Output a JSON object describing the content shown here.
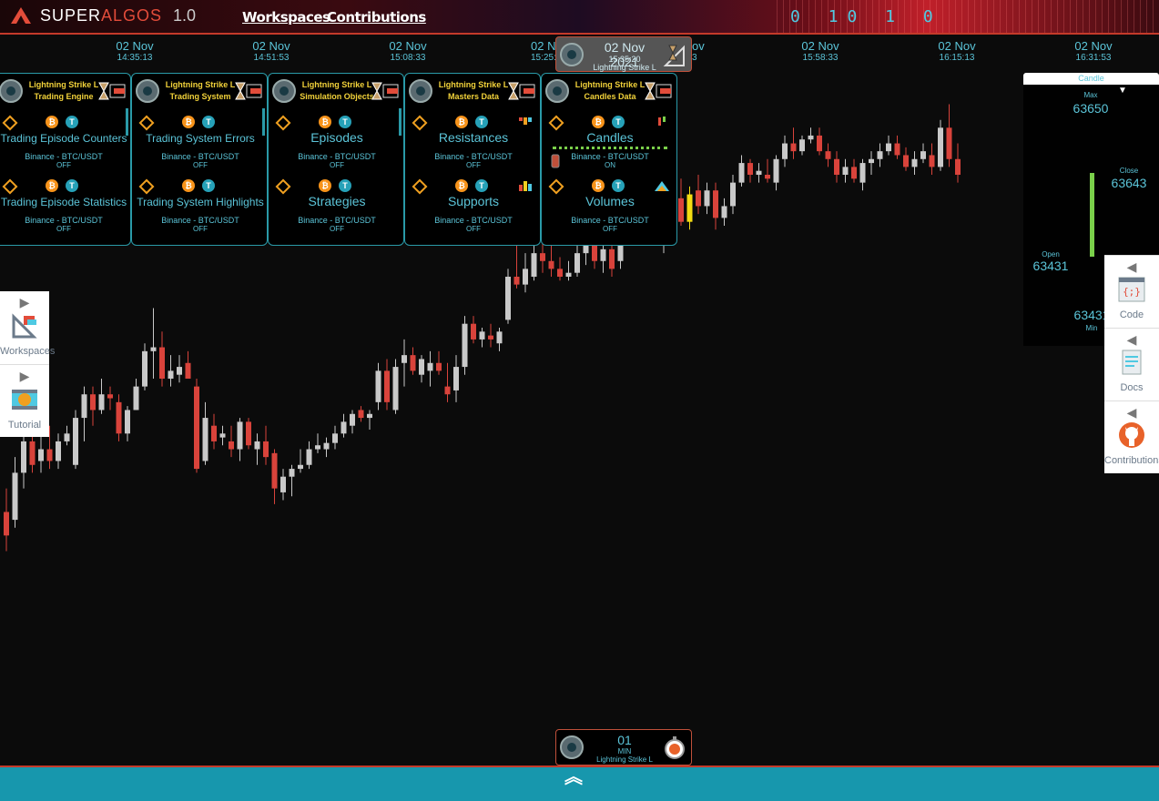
{
  "header": {
    "brand_left": "SUPER",
    "brand_right": "ALGOS",
    "version": "1.0",
    "nav": [
      {
        "label": "Workspaces"
      },
      {
        "label": "Contributions"
      }
    ],
    "binary_text": "0 10 1 0"
  },
  "timeline": [
    {
      "date": "02 Nov",
      "time": "14:35:13"
    },
    {
      "date": "02 Nov",
      "time": "14:51:53"
    },
    {
      "date": "02 Nov",
      "time": "15:08:33"
    },
    {
      "date": "02 N",
      "time": "15:25:1"
    },
    {
      "date": "ov",
      "time": "3"
    },
    {
      "date": "02 Nov",
      "time": "15:58:33"
    },
    {
      "date": "02 Nov",
      "time": "16:15:13"
    },
    {
      "date": "02 Nov",
      "time": "16:31:53"
    }
  ],
  "date_pill": {
    "date": "02 Nov 2021",
    "time": "15:35:20",
    "session": "Lightning Strike L"
  },
  "panels": [
    {
      "title1": "Lightning Strike L",
      "title2": "Trading Engine",
      "layers": [
        {
          "name": "Trading Episode Counters",
          "market": "Binance - BTC/USDT",
          "status": "OFF"
        },
        {
          "name": "Trading Episode Statistics",
          "market": "Binance - BTC/USDT",
          "status": "OFF"
        }
      ]
    },
    {
      "title1": "Lightning Strike L",
      "title2": "Trading System",
      "layers": [
        {
          "name": "Trading System Errors",
          "market": "Binance - BTC/USDT",
          "status": "OFF"
        },
        {
          "name": "Trading System Highlights",
          "market": "Binance - BTC/USDT",
          "status": "OFF"
        }
      ]
    },
    {
      "title1": "Lightning Strike L",
      "title2": "Simulation Objects",
      "layers": [
        {
          "name": "Episodes",
          "market": "Binance - BTC/USDT",
          "status": "OFF"
        },
        {
          "name": "Strategies",
          "market": "Binance - BTC/USDT",
          "status": "OFF"
        }
      ]
    },
    {
      "title1": "Lightning Strike L",
      "title2": "Masters Data",
      "layers": [
        {
          "name": "Resistances",
          "market": "Binance - BTC/USDT",
          "status": "OFF"
        },
        {
          "name": "Supports",
          "market": "Binance - BTC/USDT",
          "status": "OFF"
        }
      ]
    },
    {
      "title1": "Lightning Strike L",
      "title2": "Candles Data",
      "layers": [
        {
          "name": "Candles",
          "market": "Binance - BTC/USDT",
          "status": "ON"
        },
        {
          "name": "Volumes",
          "market": "Binance - BTC/USDT",
          "status": "OFF"
        }
      ]
    }
  ],
  "left_tabs": [
    {
      "label": "Workspaces"
    },
    {
      "label": "Tutorial"
    }
  ],
  "right_tabs": [
    {
      "label": "Code"
    },
    {
      "label": "Docs"
    },
    {
      "label": "Contributions"
    }
  ],
  "candle_panel": {
    "title": "Candle",
    "max_label": "Max",
    "max_value": "63650",
    "close_label": "Close",
    "close_value": "63643",
    "open_label": "Open",
    "open_value": "63431",
    "min_label": "Min",
    "min_value": "63431"
  },
  "time_frame": {
    "value": "01",
    "unit": "MIN",
    "session": "Lightning Strike L"
  },
  "colors": {
    "up": "#c9c9c9",
    "down": "#d9433b",
    "current": "#f4dc12",
    "accent": "#5bc4d8",
    "panel_border": "#2a9aa8",
    "bottom_bar": "#1797ad"
  },
  "chart_data": {
    "type": "candlestick",
    "title": "",
    "xlabel": "",
    "ylabel": "",
    "candles": [
      {
        "o": 62340,
        "h": 62370,
        "l": 62290,
        "c": 62310
      },
      {
        "o": 62330,
        "h": 62410,
        "l": 62320,
        "c": 62390
      },
      {
        "o": 62390,
        "h": 62440,
        "l": 62370,
        "c": 62430
      },
      {
        "o": 62430,
        "h": 62445,
        "l": 62390,
        "c": 62400
      },
      {
        "o": 62405,
        "h": 62440,
        "l": 62390,
        "c": 62420
      },
      {
        "o": 62420,
        "h": 62450,
        "l": 62395,
        "c": 62405
      },
      {
        "o": 62405,
        "h": 62440,
        "l": 62395,
        "c": 62430
      },
      {
        "o": 62430,
        "h": 62450,
        "l": 62425,
        "c": 62440
      },
      {
        "o": 62400,
        "h": 62470,
        "l": 62395,
        "c": 62460
      },
      {
        "o": 62460,
        "h": 62500,
        "l": 62430,
        "c": 62490
      },
      {
        "o": 62490,
        "h": 62500,
        "l": 62450,
        "c": 62470
      },
      {
        "o": 62470,
        "h": 62510,
        "l": 62465,
        "c": 62490
      },
      {
        "o": 62490,
        "h": 62500,
        "l": 62470,
        "c": 62485
      },
      {
        "o": 62480,
        "h": 62490,
        "l": 62430,
        "c": 62440
      },
      {
        "o": 62440,
        "h": 62475,
        "l": 62430,
        "c": 62470
      },
      {
        "o": 62470,
        "h": 62510,
        "l": 62470,
        "c": 62500
      },
      {
        "o": 62500,
        "h": 62555,
        "l": 62495,
        "c": 62545
      },
      {
        "o": 62545,
        "h": 62600,
        "l": 62510,
        "c": 62550
      },
      {
        "o": 62550,
        "h": 62570,
        "l": 62500,
        "c": 62510
      },
      {
        "o": 62510,
        "h": 62540,
        "l": 62500,
        "c": 62520
      },
      {
        "o": 62515,
        "h": 62540,
        "l": 62505,
        "c": 62525
      },
      {
        "o": 62530,
        "h": 62545,
        "l": 62510,
        "c": 62510
      },
      {
        "o": 62500,
        "h": 62510,
        "l": 62390,
        "c": 62395
      },
      {
        "o": 62405,
        "h": 62480,
        "l": 62400,
        "c": 62460
      },
      {
        "o": 62450,
        "h": 62465,
        "l": 62420,
        "c": 62430
      },
      {
        "o": 62435,
        "h": 62450,
        "l": 62425,
        "c": 62440
      },
      {
        "o": 62430,
        "h": 62450,
        "l": 62410,
        "c": 62420
      },
      {
        "o": 62420,
        "h": 62460,
        "l": 62405,
        "c": 62455
      },
      {
        "o": 62455,
        "h": 62460,
        "l": 62420,
        "c": 62425
      },
      {
        "o": 62420,
        "h": 62440,
        "l": 62400,
        "c": 62430
      },
      {
        "o": 62430,
        "h": 62450,
        "l": 62400,
        "c": 62410
      },
      {
        "o": 62415,
        "h": 62420,
        "l": 62350,
        "c": 62370
      },
      {
        "o": 62365,
        "h": 62395,
        "l": 62355,
        "c": 62385
      },
      {
        "o": 62385,
        "h": 62400,
        "l": 62360,
        "c": 62395
      },
      {
        "o": 62395,
        "h": 62420,
        "l": 62390,
        "c": 62400
      },
      {
        "o": 62400,
        "h": 62430,
        "l": 62395,
        "c": 62420
      },
      {
        "o": 62420,
        "h": 62440,
        "l": 62415,
        "c": 62425
      },
      {
        "o": 62420,
        "h": 62435,
        "l": 62410,
        "c": 62428
      },
      {
        "o": 62428,
        "h": 62450,
        "l": 62420,
        "c": 62440
      },
      {
        "o": 62440,
        "h": 62465,
        "l": 62435,
        "c": 62455
      },
      {
        "o": 62450,
        "h": 62470,
        "l": 62440,
        "c": 62465
      },
      {
        "o": 62470,
        "h": 62475,
        "l": 62455,
        "c": 62460
      },
      {
        "o": 62460,
        "h": 62470,
        "l": 62445,
        "c": 62465
      },
      {
        "o": 62480,
        "h": 62530,
        "l": 62470,
        "c": 62520
      },
      {
        "o": 62520,
        "h": 62535,
        "l": 62470,
        "c": 62480
      },
      {
        "o": 62470,
        "h": 62535,
        "l": 62465,
        "c": 62525
      },
      {
        "o": 62530,
        "h": 62560,
        "l": 62500,
        "c": 62540
      },
      {
        "o": 62540,
        "h": 62550,
        "l": 62515,
        "c": 62520
      },
      {
        "o": 62515,
        "h": 62540,
        "l": 62505,
        "c": 62535
      },
      {
        "o": 62520,
        "h": 62545,
        "l": 62500,
        "c": 62530
      },
      {
        "o": 62530,
        "h": 62545,
        "l": 62515,
        "c": 62520
      },
      {
        "o": 62500,
        "h": 62530,
        "l": 62480,
        "c": 62490
      },
      {
        "o": 62495,
        "h": 62540,
        "l": 62480,
        "c": 62525
      },
      {
        "o": 62525,
        "h": 62590,
        "l": 62515,
        "c": 62580
      },
      {
        "o": 62580,
        "h": 62590,
        "l": 62555,
        "c": 62560
      },
      {
        "o": 62560,
        "h": 62575,
        "l": 62550,
        "c": 62570
      },
      {
        "o": 62565,
        "h": 62580,
        "l": 62550,
        "c": 62560
      },
      {
        "o": 62555,
        "h": 62575,
        "l": 62545,
        "c": 62570
      },
      {
        "o": 62585,
        "h": 62650,
        "l": 62580,
        "c": 62640
      },
      {
        "o": 62640,
        "h": 62700,
        "l": 62625,
        "c": 62630
      },
      {
        "o": 62630,
        "h": 62670,
        "l": 62620,
        "c": 62650
      },
      {
        "o": 62640,
        "h": 62690,
        "l": 62635,
        "c": 62670
      },
      {
        "o": 62670,
        "h": 62700,
        "l": 62645,
        "c": 62660
      },
      {
        "o": 62660,
        "h": 62680,
        "l": 62640,
        "c": 62650
      },
      {
        "o": 62650,
        "h": 62665,
        "l": 62635,
        "c": 62640
      },
      {
        "o": 62640,
        "h": 62660,
        "l": 62635,
        "c": 62645
      },
      {
        "o": 62645,
        "h": 62680,
        "l": 62640,
        "c": 62670
      },
      {
        "o": 62670,
        "h": 62700,
        "l": 62655,
        "c": 62690
      },
      {
        "o": 62690,
        "h": 62705,
        "l": 62650,
        "c": 62660
      },
      {
        "o": 62660,
        "h": 62680,
        "l": 62645,
        "c": 62675
      },
      {
        "o": 62675,
        "h": 62690,
        "l": 62640,
        "c": 62650
      },
      {
        "o": 62660,
        "h": 62720,
        "l": 62650,
        "c": 62710
      },
      {
        "o": 62710,
        "h": 62725,
        "l": 62680,
        "c": 62690
      },
      {
        "o": 62690,
        "h": 62710,
        "l": 62685,
        "c": 62700
      },
      {
        "o": 62700,
        "h": 62720,
        "l": 62690,
        "c": 62710
      },
      {
        "o": 62715,
        "h": 62730,
        "l": 62680,
        "c": 62690
      },
      {
        "o": 62690,
        "h": 62705,
        "l": 62670,
        "c": 62700
      },
      {
        "o": 62705,
        "h": 62750,
        "l": 62700,
        "c": 62740
      },
      {
        "o": 62740,
        "h": 62765,
        "l": 62705,
        "c": 62710
      },
      {
        "o": 62710,
        "h": 62755,
        "l": 62700,
        "c": 62745
      },
      {
        "o": 62750,
        "h": 62770,
        "l": 62720,
        "c": 62730
      },
      {
        "o": 62730,
        "h": 62760,
        "l": 62720,
        "c": 62750
      },
      {
        "o": 62750,
        "h": 62760,
        "l": 62700,
        "c": 62715
      },
      {
        "o": 62715,
        "h": 62740,
        "l": 62705,
        "c": 62730
      },
      {
        "o": 62730,
        "h": 62770,
        "l": 62720,
        "c": 62760
      },
      {
        "o": 62760,
        "h": 62795,
        "l": 62755,
        "c": 62785
      },
      {
        "o": 62785,
        "h": 62790,
        "l": 62760,
        "c": 62770
      },
      {
        "o": 62770,
        "h": 62785,
        "l": 62760,
        "c": 62775
      },
      {
        "o": 62770,
        "h": 62790,
        "l": 62760,
        "c": 62765
      },
      {
        "o": 62760,
        "h": 62795,
        "l": 62750,
        "c": 62790
      },
      {
        "o": 62790,
        "h": 62820,
        "l": 62780,
        "c": 62810
      },
      {
        "o": 62810,
        "h": 62830,
        "l": 62790,
        "c": 62800
      },
      {
        "o": 62800,
        "h": 62820,
        "l": 62795,
        "c": 62815
      },
      {
        "o": 62815,
        "h": 62830,
        "l": 62810,
        "c": 62820
      },
      {
        "o": 62820,
        "h": 62830,
        "l": 62795,
        "c": 62800
      },
      {
        "o": 62800,
        "h": 62810,
        "l": 62780,
        "c": 62790
      },
      {
        "o": 62790,
        "h": 62800,
        "l": 62760,
        "c": 62770
      },
      {
        "o": 62770,
        "h": 62790,
        "l": 62760,
        "c": 62780
      },
      {
        "o": 62780,
        "h": 62790,
        "l": 62760,
        "c": 62765
      },
      {
        "o": 62760,
        "h": 62790,
        "l": 62750,
        "c": 62785
      },
      {
        "o": 62785,
        "h": 62800,
        "l": 62770,
        "c": 62790
      },
      {
        "o": 62790,
        "h": 62810,
        "l": 62780,
        "c": 62800
      },
      {
        "o": 62800,
        "h": 62820,
        "l": 62795,
        "c": 62810
      },
      {
        "o": 62810,
        "h": 62820,
        "l": 62790,
        "c": 62795
      },
      {
        "o": 62795,
        "h": 62805,
        "l": 62775,
        "c": 62780
      },
      {
        "o": 62780,
        "h": 62800,
        "l": 62770,
        "c": 62790
      },
      {
        "o": 62790,
        "h": 62810,
        "l": 62785,
        "c": 62800
      },
      {
        "o": 62795,
        "h": 62810,
        "l": 62770,
        "c": 62780
      },
      {
        "o": 62780,
        "h": 62840,
        "l": 62775,
        "c": 62830
      },
      {
        "o": 62830,
        "h": 62860,
        "l": 62780,
        "c": 62790
      },
      {
        "o": 62790,
        "h": 62810,
        "l": 62760,
        "c": 62770
      }
    ]
  }
}
